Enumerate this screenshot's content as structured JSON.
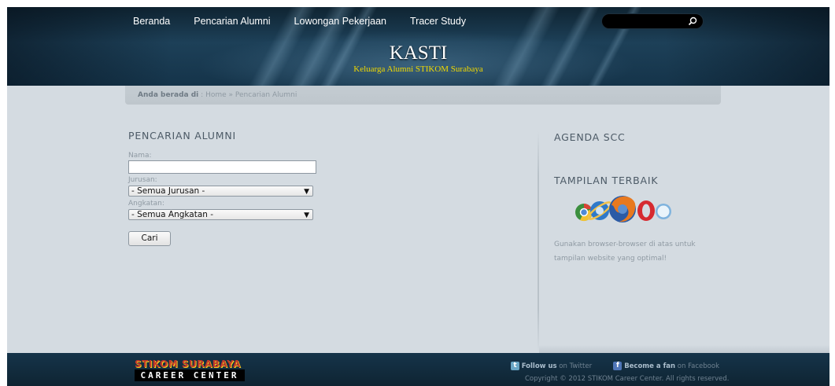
{
  "nav": {
    "items": [
      {
        "label": "Beranda"
      },
      {
        "label": "Pencarian Alumni"
      },
      {
        "label": "Lowongan Pekerjaan"
      },
      {
        "label": "Tracer Study"
      }
    ],
    "search_icon": "magnifier-icon"
  },
  "header": {
    "title": "KASTI",
    "subtitle": "Keluarga Alumni STIKOM Surabaya"
  },
  "breadcrumb": {
    "label": "Anda berada di",
    "separator": ":",
    "home": "Home",
    "arrow": "»",
    "current": "Pencarian Alumni"
  },
  "main": {
    "title": "PENCARIAN ALUMNI",
    "form": {
      "nama_label": "Nama:",
      "nama_value": "",
      "jurusan_label": "Jurusan:",
      "jurusan_selected": "- Semua Jurusan -",
      "angkatan_label": "Angkatan:",
      "angkatan_selected": "- Semua Angkatan -",
      "submit_label": "Cari"
    }
  },
  "sidebar": {
    "agenda_title": "AGENDA SCC",
    "tampilan_title": "TAMPILAN TERBAIK",
    "browser_icons": [
      "chrome-icon",
      "ie-icon",
      "firefox-icon",
      "opera-icon",
      "safari-icon"
    ],
    "browser_note": "Gunakan browser-browser di atas untuk tampilan website yang optimal!"
  },
  "footer": {
    "logo": {
      "top_text": "STIKOM SURABAYA",
      "bottom_text": "CAREER CENTER"
    },
    "twitter": {
      "strong": "Follow us",
      "rest": "on Twitter"
    },
    "facebook": {
      "strong": "Become a fan",
      "rest": "on Facebook"
    },
    "copyright": "Copyright © 2012 STIKOM Career Center. All rights reserved."
  },
  "colors": {
    "header_bg": "#1d4058",
    "page_bg": "#d4dbe1",
    "subtitle": "#f0d800",
    "footer_bg": "#0f2432"
  }
}
